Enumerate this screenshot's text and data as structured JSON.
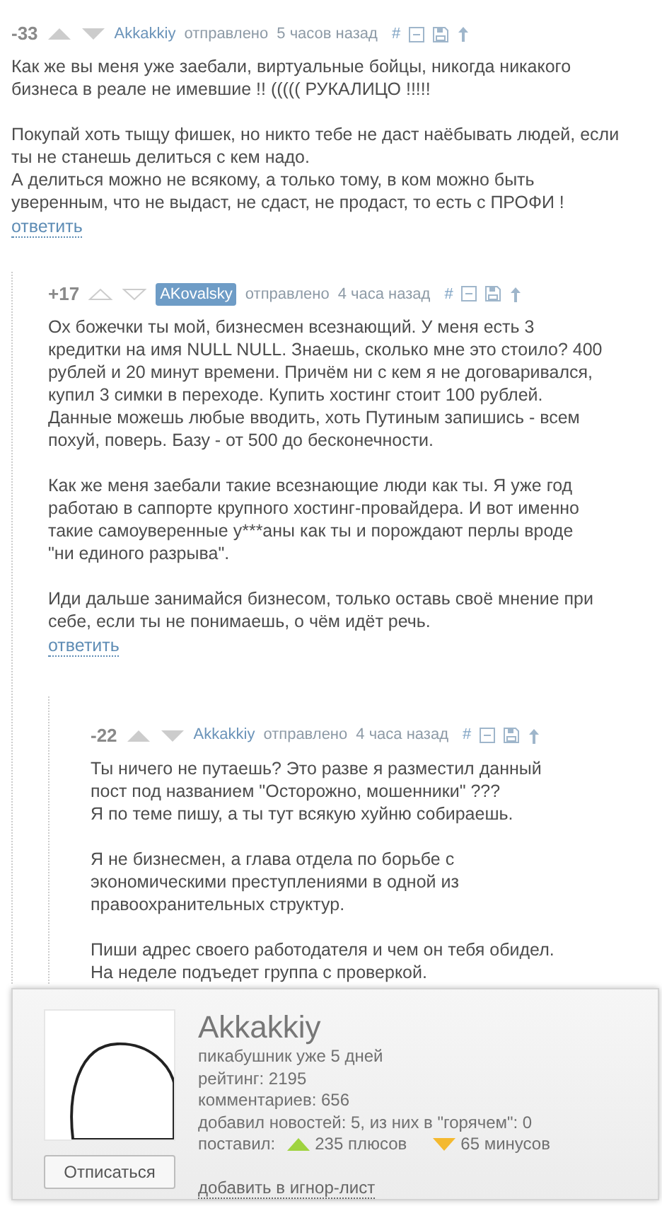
{
  "comments": [
    {
      "rating": "-33",
      "arrows_outlined": false,
      "author": "Akkakkiy",
      "author_highlighted": false,
      "sent": "отправлено",
      "time": "5 часов назад",
      "hash": "#",
      "paragraphs": [
        [
          "Как же вы меня уже заебали, виртуальные бойцы, никогда никакого",
          "бизнеса в реале не имевшие !! ((((( РУКАЛИЦО !!!!!"
        ],
        [
          "Покупай хоть тыщу фишек, но никто тебе не даст наёбывать людей, если",
          "ты не станешь делиться с кем надо.",
          "А делиться можно не всякому, а только тому, в ком можно быть",
          "уверенным, что не выдаст, не сдаст, не продаст, то есть с ПРОФИ !"
        ]
      ],
      "reply": "ответить",
      "children": [
        {
          "rating": "+17",
          "arrows_outlined": true,
          "author": "AKovalsky",
          "author_highlighted": true,
          "sent": "отправлено",
          "time": "4 часа назад",
          "hash": "#",
          "paragraphs": [
            [
              "Ох божечки ты мой, бизнесмен всезнающий. У меня есть 3",
              "кредитки на имя NULL NULL. Знаешь, сколько мне это стоило? 400",
              "рублей и 20 минут времени. Причём ни с кем я не договаривался,",
              "купил 3 симки в переходе. Купить хостинг стоит 100 рублей.",
              "Данные можешь любые вводить, хоть Путиным запишись - всем",
              "похуй, поверь. Базу - от 500 до бесконечности."
            ],
            [
              "Как же меня заебали такие всезнающие люди как ты. Я уже год",
              "работаю в саппорте крупного хостинг-провайдера. И вот именно",
              "такие самоуверенные у***аны как ты и порождают перлы вроде",
              "\"ни единого разрыва\"."
            ],
            [
              "Иди дальше занимайся бизнесом, только оставь своё мнение при",
              "себе, если ты не понимаешь, о чём идёт речь."
            ]
          ],
          "reply": "ответить",
          "children": [
            {
              "rating": "-22",
              "arrows_outlined": false,
              "author": "Akkakkiy",
              "author_highlighted": false,
              "sent": "отправлено",
              "time": "4 часа назад",
              "hash": "#",
              "paragraphs": [
                [
                  "Ты ничего не путаешь? Это разве я разместил данный",
                  "пост под названием \"Осторожно, мошенники\" ???",
                  "Я по теме пишу, а ты тут всякую хуйню собираешь."
                ],
                [
                  "Я не бизнесмен, а глава отдела по борьбе с",
                  "экономическими преступлениями в одной из",
                  "правоохранительных структур."
                ],
                [
                  "Пиши адрес своего работодателя и чем он тебя обидел.",
                  "На неделе подъедет группа с проверкой."
                ]
              ]
            }
          ]
        }
      ]
    }
  ],
  "profile": {
    "name": "Akkakkiy",
    "lines": [
      "пикабушник уже 5 дней",
      "рейтинг: 2195",
      "комментариев: 656",
      "добавил новостей: 5, из них в \"горячем\": 0"
    ],
    "votes_label": "поставил:",
    "pluses": "235 плюсов",
    "minuses": "65 минусов",
    "button": "Отписаться",
    "ignore_link": "добавить в игнор-лист"
  }
}
